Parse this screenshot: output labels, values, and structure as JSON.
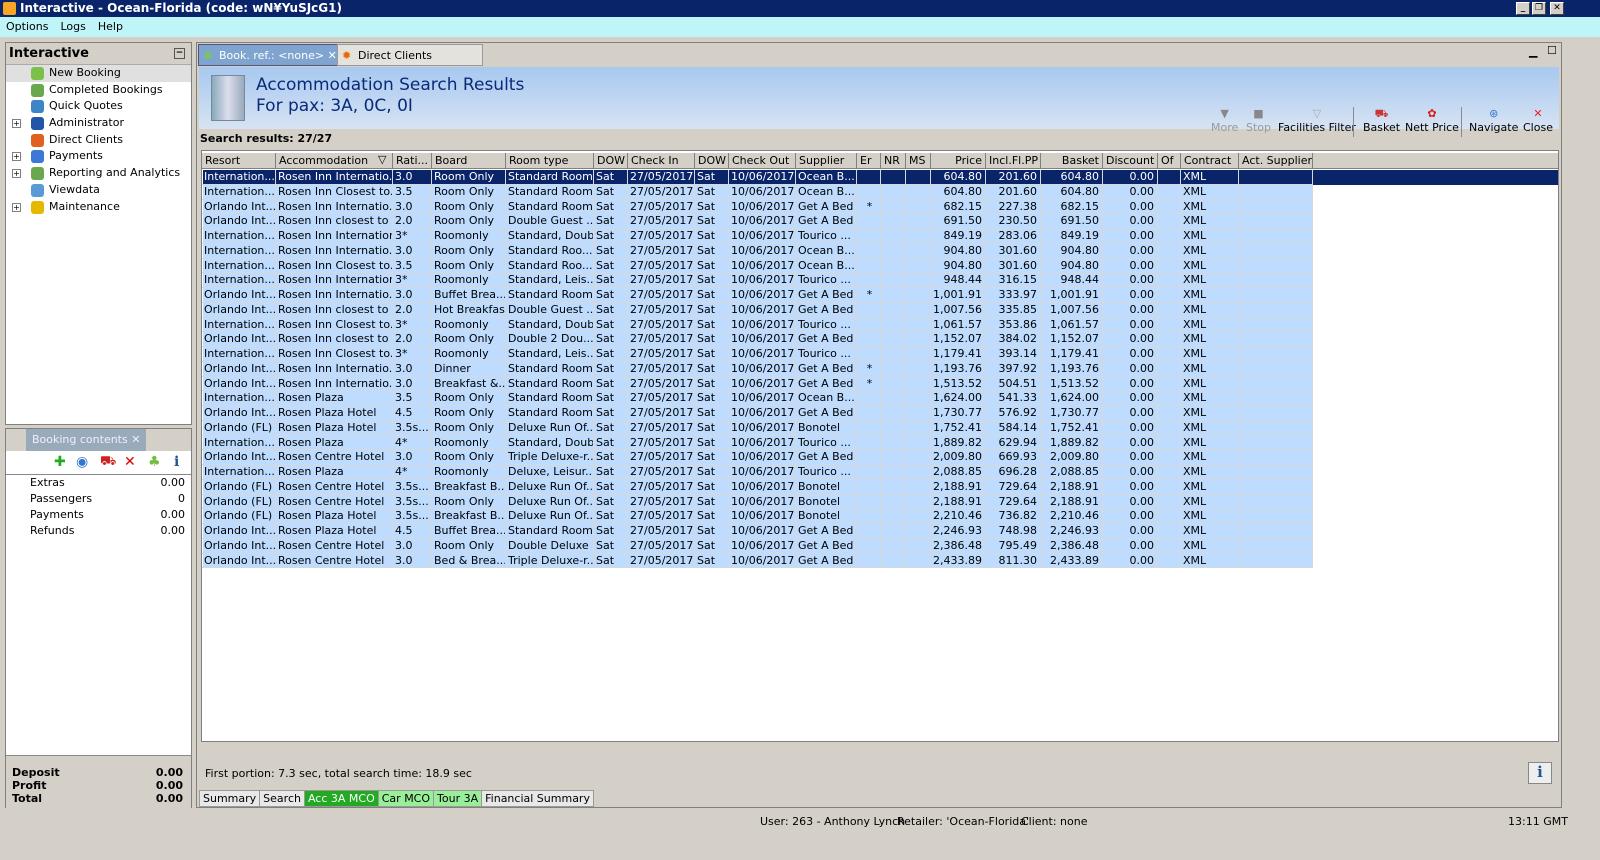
{
  "window": {
    "title": "Interactive - Ocean-Florida (code: wN¥YuSJcG1)"
  },
  "menu": [
    "Options",
    "Logs",
    "Help"
  ],
  "nav": {
    "title": "Interactive",
    "items": [
      {
        "label": "New Booking",
        "color": "#7cc04a",
        "expand": false
      },
      {
        "label": "Completed Bookings",
        "color": "#6aa84f",
        "expand": false
      },
      {
        "label": "Quick Quotes",
        "color": "#3d85c6",
        "expand": false
      },
      {
        "label": "Administrator",
        "color": "#2255aa",
        "expand": true
      },
      {
        "label": "Direct Clients",
        "color": "#e06020",
        "expand": false
      },
      {
        "label": "Payments",
        "color": "#3c78d8",
        "expand": true
      },
      {
        "label": "Reporting and Analytics",
        "color": "#6aa84f",
        "expand": true
      },
      {
        "label": "Viewdata",
        "color": "#5b9bd5",
        "expand": false
      },
      {
        "label": "Maintenance",
        "color": "#e6b800",
        "expand": true
      }
    ]
  },
  "booking": {
    "tab": "Booking contents",
    "rows": [
      {
        "label": "Extras",
        "value": "0.00"
      },
      {
        "label": "Passengers",
        "value": "0"
      },
      {
        "label": "Payments",
        "value": "0.00"
      },
      {
        "label": "Refunds",
        "value": "0.00"
      }
    ],
    "totals": [
      {
        "label": "Deposit",
        "value": "0.00"
      },
      {
        "label": "Profit",
        "value": "0.00"
      },
      {
        "label": "Total",
        "value": "0.00"
      }
    ]
  },
  "tabs": [
    {
      "label": "Book. ref.: <none>",
      "active": true
    },
    {
      "label": "Direct Clients Search",
      "active": false
    }
  ],
  "header": {
    "title": "Accommodation Search Results",
    "subtitle": "For pax: 3A, 0C, 0I"
  },
  "toolbar": [
    {
      "label": "More",
      "icon": "triangle-down-icon",
      "enabled": false
    },
    {
      "label": "Stop",
      "icon": "stop-icon",
      "enabled": false
    },
    {
      "label": "Facilities Filter",
      "icon": "funnel-icon",
      "enabled": true
    },
    {
      "label": "Basket",
      "icon": "basket-icon",
      "enabled": true
    },
    {
      "label": "Nett Price",
      "icon": "nett-price-icon",
      "enabled": true
    },
    {
      "label": "Navigate",
      "icon": "compass-icon",
      "enabled": true
    },
    {
      "label": "Close",
      "icon": "close-icon",
      "enabled": true
    }
  ],
  "results_label": "Search results: 27/27",
  "columns": [
    "Resort",
    "Accommodation",
    "Rati...",
    "Board",
    "Room type",
    "DOW",
    "Check In",
    "DOW",
    "Check Out",
    "Supplier",
    "Er",
    "NR",
    "MS",
    "Price",
    "Incl.Fl.PP",
    "Basket",
    "Discount",
    "Of",
    "Contract",
    "Act. Supplier"
  ],
  "rows": [
    [
      "Internation...",
      "Rosen Inn Internatio...",
      "3.0",
      "Room Only",
      "Standard Room",
      "Sat",
      "27/05/2017",
      "Sat",
      "10/06/2017",
      "Ocean B...",
      "",
      "",
      "",
      "604.80",
      "201.60",
      "604.80",
      "0.00",
      "",
      "XML",
      ""
    ],
    [
      "Internation...",
      "Rosen Inn Closest to...",
      "3.5",
      "Room Only",
      "Standard Room",
      "Sat",
      "27/05/2017",
      "Sat",
      "10/06/2017",
      "Ocean B...",
      "",
      "",
      "",
      "604.80",
      "201.60",
      "604.80",
      "0.00",
      "",
      "XML",
      ""
    ],
    [
      "Orlando Int...",
      "Rosen Inn Internatio...",
      "3.0",
      "Room Only",
      "Standard Room",
      "Sat",
      "27/05/2017",
      "Sat",
      "10/06/2017",
      "Get A Bed",
      "*",
      "",
      "",
      "682.15",
      "227.38",
      "682.15",
      "0.00",
      "",
      "XML",
      ""
    ],
    [
      "Orlando Int...",
      "Rosen Inn closest to ...",
      "2.0",
      "Room Only",
      "Double Guest ...",
      "Sat",
      "27/05/2017",
      "Sat",
      "10/06/2017",
      "Get A Bed",
      "",
      "",
      "",
      "691.50",
      "230.50",
      "691.50",
      "0.00",
      "",
      "XML",
      ""
    ],
    [
      "Internation...",
      "Rosen Inn International",
      "3*",
      "Roomonly",
      "Standard, Double",
      "Sat",
      "27/05/2017",
      "Sat",
      "10/06/2017",
      "Tourico ...",
      "",
      "",
      "",
      "849.19",
      "283.06",
      "849.19",
      "0.00",
      "",
      "XML",
      ""
    ],
    [
      "Internation...",
      "Rosen Inn Internatio...",
      "3.0",
      "Room Only",
      "Standard Roo...",
      "Sat",
      "27/05/2017",
      "Sat",
      "10/06/2017",
      "Ocean B...",
      "",
      "",
      "",
      "904.80",
      "301.60",
      "904.80",
      "0.00",
      "",
      "XML",
      ""
    ],
    [
      "Internation...",
      "Rosen Inn Closest to...",
      "3.5",
      "Room Only",
      "Standard Roo...",
      "Sat",
      "27/05/2017",
      "Sat",
      "10/06/2017",
      "Ocean B...",
      "",
      "",
      "",
      "904.80",
      "301.60",
      "904.80",
      "0.00",
      "",
      "XML",
      ""
    ],
    [
      "Internation...",
      "Rosen Inn International",
      "3*",
      "Roomonly",
      "Standard, Leis...",
      "Sat",
      "27/05/2017",
      "Sat",
      "10/06/2017",
      "Tourico ...",
      "",
      "",
      "",
      "948.44",
      "316.15",
      "948.44",
      "0.00",
      "",
      "XML",
      ""
    ],
    [
      "Orlando Int...",
      "Rosen Inn Internatio...",
      "3.0",
      "Buffet Brea...",
      "Standard Room",
      "Sat",
      "27/05/2017",
      "Sat",
      "10/06/2017",
      "Get A Bed",
      "*",
      "",
      "",
      "1,001.91",
      "333.97",
      "1,001.91",
      "0.00",
      "",
      "XML",
      ""
    ],
    [
      "Orlando Int...",
      "Rosen Inn closest to ...",
      "2.0",
      "Hot Breakfast",
      "Double Guest ...",
      "Sat",
      "27/05/2017",
      "Sat",
      "10/06/2017",
      "Get A Bed",
      "",
      "",
      "",
      "1,007.56",
      "335.85",
      "1,007.56",
      "0.00",
      "",
      "XML",
      ""
    ],
    [
      "Internation...",
      "Rosen Inn Closest to...",
      "3*",
      "Roomonly",
      "Standard, Double",
      "Sat",
      "27/05/2017",
      "Sat",
      "10/06/2017",
      "Tourico ...",
      "",
      "",
      "",
      "1,061.57",
      "353.86",
      "1,061.57",
      "0.00",
      "",
      "XML",
      ""
    ],
    [
      "Orlando Int...",
      "Rosen Inn closest to ...",
      "2.0",
      "Room Only",
      "Double 2  Dou...",
      "Sat",
      "27/05/2017",
      "Sat",
      "10/06/2017",
      "Get A Bed",
      "",
      "",
      "",
      "1,152.07",
      "384.02",
      "1,152.07",
      "0.00",
      "",
      "XML",
      ""
    ],
    [
      "Internation...",
      "Rosen Inn Closest to...",
      "3*",
      "Roomonly",
      "Standard, Leis...",
      "Sat",
      "27/05/2017",
      "Sat",
      "10/06/2017",
      "Tourico ...",
      "",
      "",
      "",
      "1,179.41",
      "393.14",
      "1,179.41",
      "0.00",
      "",
      "XML",
      ""
    ],
    [
      "Orlando Int...",
      "Rosen Inn Internatio...",
      "3.0",
      "Dinner",
      "Standard Room",
      "Sat",
      "27/05/2017",
      "Sat",
      "10/06/2017",
      "Get A Bed",
      "*",
      "",
      "",
      "1,193.76",
      "397.92",
      "1,193.76",
      "0.00",
      "",
      "XML",
      ""
    ],
    [
      "Orlando Int...",
      "Rosen Inn Internatio...",
      "3.0",
      "Breakfast &...",
      "Standard Room",
      "Sat",
      "27/05/2017",
      "Sat",
      "10/06/2017",
      "Get A Bed",
      "*",
      "",
      "",
      "1,513.52",
      "504.51",
      "1,513.52",
      "0.00",
      "",
      "XML",
      ""
    ],
    [
      "Internation...",
      "Rosen Plaza",
      "3.5",
      "Room Only",
      "Standard Room",
      "Sat",
      "27/05/2017",
      "Sat",
      "10/06/2017",
      "Ocean B...",
      "",
      "",
      "",
      "1,624.00",
      "541.33",
      "1,624.00",
      "0.00",
      "",
      "XML",
      ""
    ],
    [
      "Orlando Int...",
      "Rosen Plaza Hotel",
      "4.5",
      "Room Only",
      "Standard Room",
      "Sat",
      "27/05/2017",
      "Sat",
      "10/06/2017",
      "Get A Bed",
      "",
      "",
      "",
      "1,730.77",
      "576.92",
      "1,730.77",
      "0.00",
      "",
      "XML",
      ""
    ],
    [
      "Orlando (FL)",
      "Rosen Plaza Hotel",
      "3.5s...",
      "Room Only",
      "Deluxe Run Of...",
      "Sat",
      "27/05/2017",
      "Sat",
      "10/06/2017",
      "Bonotel",
      "",
      "",
      "",
      "1,752.41",
      "584.14",
      "1,752.41",
      "0.00",
      "",
      "XML",
      ""
    ],
    [
      "Internation...",
      "Rosen Plaza",
      "4*",
      "Roomonly",
      "Standard, Double",
      "Sat",
      "27/05/2017",
      "Sat",
      "10/06/2017",
      "Tourico ...",
      "",
      "",
      "",
      "1,889.82",
      "629.94",
      "1,889.82",
      "0.00",
      "",
      "XML",
      ""
    ],
    [
      "Orlando Int...",
      "Rosen Centre Hotel",
      "3.0",
      "Room Only",
      "Triple Deluxe-r...",
      "Sat",
      "27/05/2017",
      "Sat",
      "10/06/2017",
      "Get A Bed",
      "",
      "",
      "",
      "2,009.80",
      "669.93",
      "2,009.80",
      "0.00",
      "",
      "XML",
      ""
    ],
    [
      "Internation...",
      "Rosen Plaza",
      "4*",
      "Roomonly",
      "Deluxe, Leisur...",
      "Sat",
      "27/05/2017",
      "Sat",
      "10/06/2017",
      "Tourico ...",
      "",
      "",
      "",
      "2,088.85",
      "696.28",
      "2,088.85",
      "0.00",
      "",
      "XML",
      ""
    ],
    [
      "Orlando (FL)",
      "Rosen Centre Hotel",
      "3.5s...",
      "Breakfast B...",
      "Deluxe Run Of...",
      "Sat",
      "27/05/2017",
      "Sat",
      "10/06/2017",
      "Bonotel",
      "",
      "",
      "",
      "2,188.91",
      "729.64",
      "2,188.91",
      "0.00",
      "",
      "XML",
      ""
    ],
    [
      "Orlando (FL)",
      "Rosen Centre Hotel",
      "3.5s...",
      "Room Only",
      "Deluxe Run Of...",
      "Sat",
      "27/05/2017",
      "Sat",
      "10/06/2017",
      "Bonotel",
      "",
      "",
      "",
      "2,188.91",
      "729.64",
      "2,188.91",
      "0.00",
      "",
      "XML",
      ""
    ],
    [
      "Orlando (FL)",
      "Rosen Plaza Hotel",
      "3.5s...",
      "Breakfast B...",
      "Deluxe Run Of...",
      "Sat",
      "27/05/2017",
      "Sat",
      "10/06/2017",
      "Bonotel",
      "",
      "",
      "",
      "2,210.46",
      "736.82",
      "2,210.46",
      "0.00",
      "",
      "XML",
      ""
    ],
    [
      "Orlando Int...",
      "Rosen Plaza Hotel",
      "4.5",
      "Buffet Brea...",
      "Standard Room",
      "Sat",
      "27/05/2017",
      "Sat",
      "10/06/2017",
      "Get A Bed",
      "",
      "",
      "",
      "2,246.93",
      "748.98",
      "2,246.93",
      "0.00",
      "",
      "XML",
      ""
    ],
    [
      "Orlando Int...",
      "Rosen Centre Hotel",
      "3.0",
      "Room Only",
      "Double Deluxe",
      "Sat",
      "27/05/2017",
      "Sat",
      "10/06/2017",
      "Get A Bed",
      "",
      "",
      "",
      "2,386.48",
      "795.49",
      "2,386.48",
      "0.00",
      "",
      "XML",
      ""
    ],
    [
      "Orlando Int...",
      "Rosen Centre Hotel",
      "3.0",
      "Bed & Brea...",
      "Triple Deluxe-r...",
      "Sat",
      "27/05/2017",
      "Sat",
      "10/06/2017",
      "Get A Bed",
      "",
      "",
      "",
      "2,433.89",
      "811.30",
      "2,433.89",
      "0.00",
      "",
      "XML",
      ""
    ]
  ],
  "timing": "First portion: 7.3 sec, total search time: 18.9 sec",
  "bottom_tabs": [
    {
      "label": "Summary",
      "style": ""
    },
    {
      "label": "Search",
      "style": ""
    },
    {
      "label": "Acc 3A MCO",
      "style": "g"
    },
    {
      "label": "Car MCO",
      "style": "lg"
    },
    {
      "label": "Tour 3A",
      "style": "lg"
    },
    {
      "label": "Financial Summary",
      "style": ""
    }
  ],
  "status": {
    "user": "User: 263 - Anthony Lynch",
    "retailer": "Retailer: 'Ocean-Florida'",
    "client": "Client: none",
    "time": "13:11 GMT"
  },
  "colors": {
    "selected_row": "#0a246a",
    "row": "#bddcff",
    "titlebar": "#0a246a"
  }
}
